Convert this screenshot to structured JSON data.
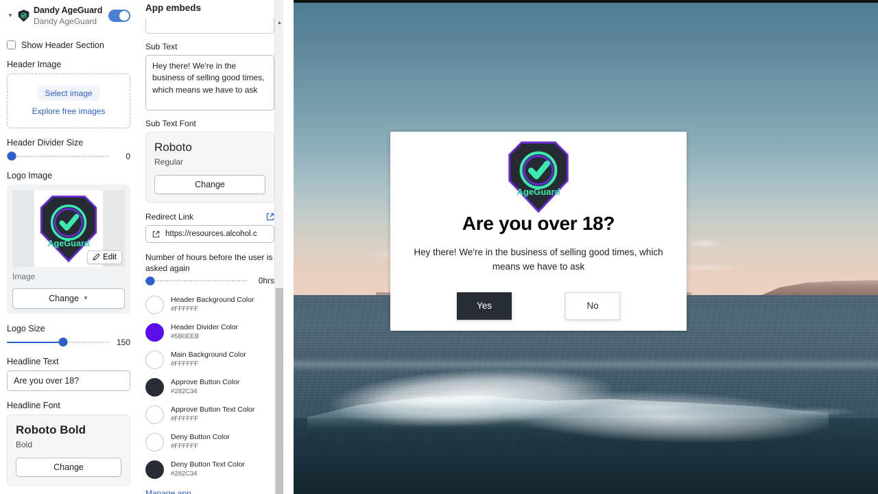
{
  "app_header": {
    "title": "Dandy AgeGuard",
    "subtitle": "Dandy AgeGuard",
    "toggle_on": true
  },
  "left_panel": {
    "show_header_section_label": "Show Header Section",
    "show_header_section_checked": false,
    "header_image_label": "Header Image",
    "select_image_button": "Select image",
    "explore_free_images_link": "Explore free images",
    "header_divider_size_label": "Header Divider Size",
    "header_divider_size_value": "0",
    "logo_image_label": "Logo Image",
    "logo_edit_button": "Edit",
    "logo_image_caption": "Image",
    "logo_change_button": "Change",
    "logo_size_label": "Logo Size",
    "logo_size_value": "150",
    "headline_text_label": "Headline Text",
    "headline_text_value": "Are you over 18?",
    "headline_font_label": "Headline Font",
    "headline_font_name": "Roboto Bold",
    "headline_font_style": "Bold",
    "headline_font_change_button": "Change"
  },
  "mid_panel": {
    "heading": "App embeds",
    "sub_text_label": "Sub Text",
    "sub_text_value": "Hey there! We're in the business of selling good times, which means we have to ask",
    "sub_text_font_label": "Sub Text Font",
    "sub_text_font_name": "Roboto",
    "sub_text_font_style": "Regular",
    "sub_text_font_change_button": "Change",
    "redirect_link_label": "Redirect Link",
    "redirect_link_value": "https://resources.alcohol.c",
    "hours_label": "Number of hours before the user is asked again",
    "hours_value": "0hrs",
    "colors": [
      {
        "name": "Header Background Color",
        "hex": "#FFFFFF"
      },
      {
        "name": "Header Divider Color",
        "hex": "#5B0EEB"
      },
      {
        "name": "Main Background Color",
        "hex": "#FFFFFF"
      },
      {
        "name": "Approve Button Color",
        "hex": "#282C34"
      },
      {
        "name": "Approve Button Text Color",
        "hex": "#FFFFFF"
      },
      {
        "name": "Deny Button Color",
        "hex": "#FFFFFF"
      },
      {
        "name": "Deny Button Text Color",
        "hex": "#282C34"
      }
    ],
    "manage_app_link": "Manage app"
  },
  "preview_modal": {
    "logo_brand_text": "AgeGuard",
    "headline": "Are you over 18?",
    "subtext": "Hey there! We're in the business of selling good times, which means we have to ask",
    "approve_button": "Yes",
    "deny_button": "No"
  },
  "theme": {
    "accent_blue": "#2c5ecf",
    "toggle_blue": "#4b7fd1",
    "logo_shield_dark": "#282C34",
    "logo_green": "#3DE8AE",
    "logo_purple": "#6B2BD9"
  }
}
